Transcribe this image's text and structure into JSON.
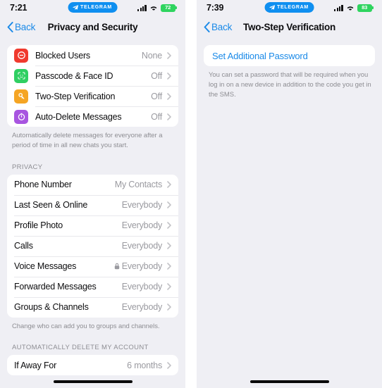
{
  "left_phone": {
    "status_bar": {
      "time": "7:21",
      "app_badge": "TELEGRAM",
      "battery_level": "72",
      "battery_color": "#2fd45f"
    },
    "nav": {
      "back_label": "Back",
      "title": "Privacy and Security"
    },
    "security_group": {
      "items": [
        {
          "icon": "block-user-icon",
          "icon_color": "#f03a2e",
          "label": "Blocked Users",
          "value": "None"
        },
        {
          "icon": "face-id-icon",
          "icon_color": "#2fcf62",
          "label": "Passcode & Face ID",
          "value": "Off"
        },
        {
          "icon": "key-icon",
          "icon_color": "#f5a524",
          "label": "Two-Step Verification",
          "value": "Off"
        },
        {
          "icon": "auto-delete-timer-icon",
          "icon_color": "#a855e0",
          "label": "Auto-Delete Messages",
          "value": "Off"
        }
      ],
      "footnote": "Automatically delete messages for everyone after a period of time in all new chats you start."
    },
    "privacy_group": {
      "header": "PRIVACY",
      "items": [
        {
          "label": "Phone Number",
          "value": "My Contacts",
          "locked": false
        },
        {
          "label": "Last Seen & Online",
          "value": "Everybody",
          "locked": false
        },
        {
          "label": "Profile Photo",
          "value": "Everybody",
          "locked": false
        },
        {
          "label": "Calls",
          "value": "Everybody",
          "locked": false
        },
        {
          "label": "Voice Messages",
          "value": "Everybody",
          "locked": true
        },
        {
          "label": "Forwarded Messages",
          "value": "Everybody",
          "locked": false
        },
        {
          "label": "Groups & Channels",
          "value": "Everybody",
          "locked": false
        }
      ],
      "footnote": "Change who can add you to groups and channels."
    },
    "auto_delete_group": {
      "header": "AUTOMATICALLY DELETE MY ACCOUNT",
      "items": [
        {
          "label": "If Away For",
          "value": "6 months"
        }
      ]
    }
  },
  "right_phone": {
    "status_bar": {
      "time": "7:39",
      "app_badge": "TELEGRAM",
      "battery_level": "83",
      "battery_color": "#2fd45f"
    },
    "nav": {
      "back_label": "Back",
      "title": "Two-Step Verification"
    },
    "password_group": {
      "action_label": "Set Additional Password",
      "footnote": "You can set a password that will be required when you log in on a new device in addition to the code you get in the SMS."
    }
  },
  "colors": {
    "accent_blue": "#1b8ae8",
    "page_background": "#efeff4",
    "card_background": "#ffffff",
    "value_gray": "#9a9aa0"
  }
}
